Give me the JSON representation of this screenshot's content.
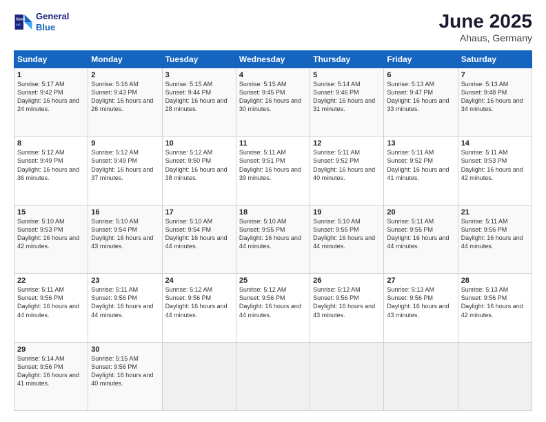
{
  "header": {
    "logo_line1": "General",
    "logo_line2": "Blue",
    "title": "June 2025",
    "subtitle": "Ahaus, Germany"
  },
  "days_of_week": [
    "Sunday",
    "Monday",
    "Tuesday",
    "Wednesday",
    "Thursday",
    "Friday",
    "Saturday"
  ],
  "weeks": [
    [
      {
        "day": "1",
        "sunrise": "5:17 AM",
        "sunset": "9:42 PM",
        "daylight": "16 hours and 24 minutes."
      },
      {
        "day": "2",
        "sunrise": "5:16 AM",
        "sunset": "9:43 PM",
        "daylight": "16 hours and 26 minutes."
      },
      {
        "day": "3",
        "sunrise": "5:15 AM",
        "sunset": "9:44 PM",
        "daylight": "16 hours and 28 minutes."
      },
      {
        "day": "4",
        "sunrise": "5:15 AM",
        "sunset": "9:45 PM",
        "daylight": "16 hours and 30 minutes."
      },
      {
        "day": "5",
        "sunrise": "5:14 AM",
        "sunset": "9:46 PM",
        "daylight": "16 hours and 31 minutes."
      },
      {
        "day": "6",
        "sunrise": "5:13 AM",
        "sunset": "9:47 PM",
        "daylight": "16 hours and 33 minutes."
      },
      {
        "day": "7",
        "sunrise": "5:13 AM",
        "sunset": "9:48 PM",
        "daylight": "16 hours and 34 minutes."
      }
    ],
    [
      {
        "day": "8",
        "sunrise": "5:12 AM",
        "sunset": "9:49 PM",
        "daylight": "16 hours and 36 minutes."
      },
      {
        "day": "9",
        "sunrise": "5:12 AM",
        "sunset": "9:49 PM",
        "daylight": "16 hours and 37 minutes."
      },
      {
        "day": "10",
        "sunrise": "5:12 AM",
        "sunset": "9:50 PM",
        "daylight": "16 hours and 38 minutes."
      },
      {
        "day": "11",
        "sunrise": "5:11 AM",
        "sunset": "9:51 PM",
        "daylight": "16 hours and 39 minutes."
      },
      {
        "day": "12",
        "sunrise": "5:11 AM",
        "sunset": "9:52 PM",
        "daylight": "16 hours and 40 minutes."
      },
      {
        "day": "13",
        "sunrise": "5:11 AM",
        "sunset": "9:52 PM",
        "daylight": "16 hours and 41 minutes."
      },
      {
        "day": "14",
        "sunrise": "5:11 AM",
        "sunset": "9:53 PM",
        "daylight": "16 hours and 42 minutes."
      }
    ],
    [
      {
        "day": "15",
        "sunrise": "5:10 AM",
        "sunset": "9:53 PM",
        "daylight": "16 hours and 42 minutes."
      },
      {
        "day": "16",
        "sunrise": "5:10 AM",
        "sunset": "9:54 PM",
        "daylight": "16 hours and 43 minutes."
      },
      {
        "day": "17",
        "sunrise": "5:10 AM",
        "sunset": "9:54 PM",
        "daylight": "16 hours and 44 minutes."
      },
      {
        "day": "18",
        "sunrise": "5:10 AM",
        "sunset": "9:55 PM",
        "daylight": "16 hours and 44 minutes."
      },
      {
        "day": "19",
        "sunrise": "5:10 AM",
        "sunset": "9:55 PM",
        "daylight": "16 hours and 44 minutes."
      },
      {
        "day": "20",
        "sunrise": "5:11 AM",
        "sunset": "9:55 PM",
        "daylight": "16 hours and 44 minutes."
      },
      {
        "day": "21",
        "sunrise": "5:11 AM",
        "sunset": "9:56 PM",
        "daylight": "16 hours and 44 minutes."
      }
    ],
    [
      {
        "day": "22",
        "sunrise": "5:11 AM",
        "sunset": "9:56 PM",
        "daylight": "16 hours and 44 minutes."
      },
      {
        "day": "23",
        "sunrise": "5:11 AM",
        "sunset": "9:56 PM",
        "daylight": "16 hours and 44 minutes."
      },
      {
        "day": "24",
        "sunrise": "5:12 AM",
        "sunset": "9:56 PM",
        "daylight": "16 hours and 44 minutes."
      },
      {
        "day": "25",
        "sunrise": "5:12 AM",
        "sunset": "9:56 PM",
        "daylight": "16 hours and 44 minutes."
      },
      {
        "day": "26",
        "sunrise": "5:12 AM",
        "sunset": "9:56 PM",
        "daylight": "16 hours and 43 minutes."
      },
      {
        "day": "27",
        "sunrise": "5:13 AM",
        "sunset": "9:56 PM",
        "daylight": "16 hours and 43 minutes."
      },
      {
        "day": "28",
        "sunrise": "5:13 AM",
        "sunset": "9:56 PM",
        "daylight": "16 hours and 42 minutes."
      }
    ],
    [
      {
        "day": "29",
        "sunrise": "5:14 AM",
        "sunset": "9:56 PM",
        "daylight": "16 hours and 41 minutes."
      },
      {
        "day": "30",
        "sunrise": "5:15 AM",
        "sunset": "9:56 PM",
        "daylight": "16 hours and 40 minutes."
      },
      null,
      null,
      null,
      null,
      null
    ]
  ]
}
